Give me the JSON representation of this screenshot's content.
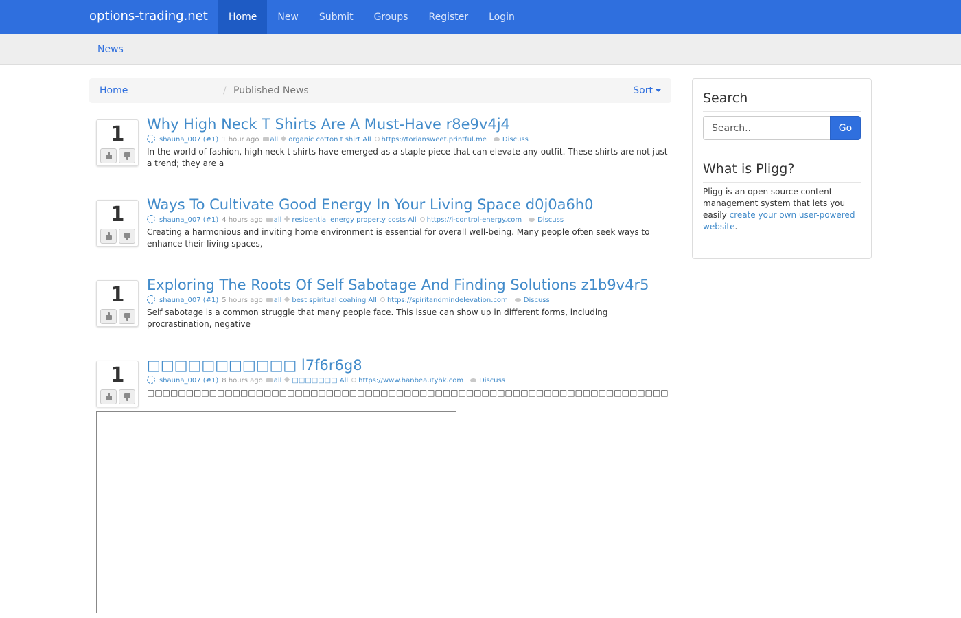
{
  "navbar": {
    "brand": "options-trading.net",
    "items": [
      {
        "label": "Home",
        "active": true
      },
      {
        "label": "New"
      },
      {
        "label": "Submit"
      },
      {
        "label": "Groups"
      },
      {
        "label": "Register"
      },
      {
        "label": "Login"
      }
    ],
    "color": "#2f6fde"
  },
  "subnav": {
    "items": [
      {
        "label": "News"
      }
    ]
  },
  "breadcrumb": {
    "home": "Home",
    "separator": "/",
    "current": "Published News",
    "sort_label": "Sort"
  },
  "stories": [
    {
      "votes": "1",
      "title": "Why High Neck T Shirts Are A Must-Have r8e9v4j4",
      "author": "shauna_007 (#1)",
      "time": "1 hour ago",
      "category": "all",
      "tags": "organic cotton t shirt All",
      "url": "https://toriansweet.printful.me",
      "discuss": "Discuss",
      "body": "In the world of fashion, high neck t shirts have emerged as a staple piece that can elevate any outfit. These shirts are not just a trend; they are a"
    },
    {
      "votes": "1",
      "title": "Ways To Cultivate Good Energy In Your Living Space d0j0a6h0",
      "author": "shauna_007 (#1)",
      "time": "4 hours ago",
      "category": "all",
      "tags": "residential energy property costs All",
      "url": "https://i-control-energy.com",
      "discuss": "Discuss",
      "body": "Creating a harmonious and inviting home environment is essential for overall well-being. Many people often seek ways to enhance their living spaces,"
    },
    {
      "votes": "1",
      "title": "Exploring The Roots Of Self Sabotage And Finding Solutions z1b9v4r5",
      "author": "shauna_007 (#1)",
      "time": "5 hours ago",
      "category": "all",
      "tags": "best spiritual coahing All",
      "url": "https://spiritandmindelevation.com",
      "discuss": "Discuss",
      "body": "Self sabotage is a common struggle that many people face. This issue can show up in different forms, including procrastination, negative"
    },
    {
      "votes": "1",
      "title": "□□□□□□□□□□□ l7f6r6g8",
      "author": "shauna_007 (#1)",
      "time": "8 hours ago",
      "category": "all",
      "tags": "□□□□□□□ All",
      "url": "https://www.hanbeautyhk.com",
      "discuss": "Discuss",
      "body": "□□□□□□□□□□□□□□□□□□□□□□□□□□□□□□□□□□□□□□□□□□□□□□□□□□□□□□□□□□□□□□□□□□□□□□□□□□□□□□□□□"
    }
  ],
  "sidebar": {
    "search_heading": "Search",
    "search_placeholder": "Search..",
    "search_button": "Go",
    "about_heading": "What is Pligg?",
    "about_text": "Pligg is an open source content management system that lets you easily",
    "about_link": "create your own user-powered website",
    "about_end": "."
  }
}
